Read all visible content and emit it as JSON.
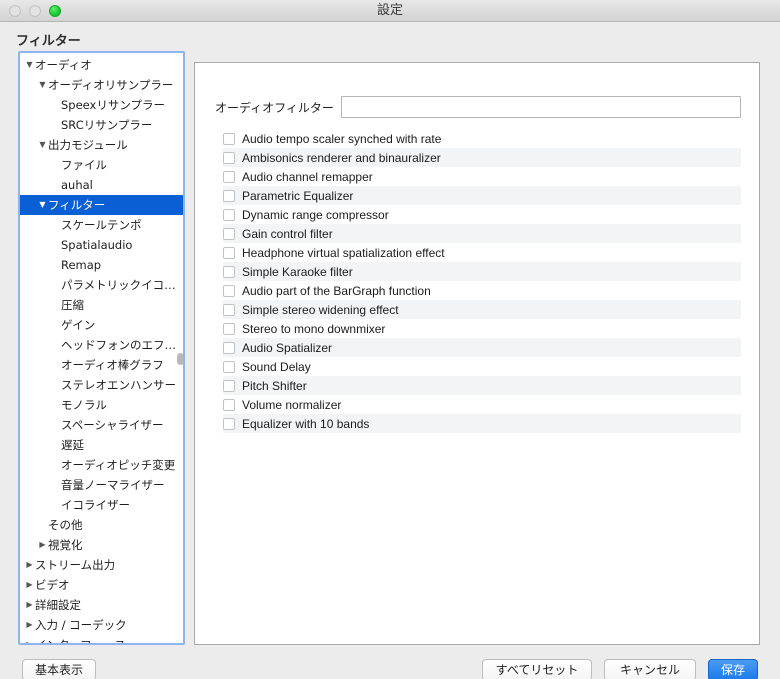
{
  "window": {
    "title": "設定",
    "traffic_lights": [
      "close-button",
      "minimize-button",
      "maximize-button"
    ],
    "accent_blue": "#0a5fd4",
    "save_blue": "#1b7ae8"
  },
  "page": {
    "heading": "フィルター"
  },
  "tree": {
    "items": [
      {
        "label": "オーディオ",
        "level": 0,
        "twisty": "▼",
        "selected": false
      },
      {
        "label": "オーディオリサンプラー",
        "level": 1,
        "twisty": "▼",
        "selected": false
      },
      {
        "label": "Speexリサンプラー",
        "level": 2,
        "twisty": "",
        "selected": false
      },
      {
        "label": "SRCリサンプラー",
        "level": 2,
        "twisty": "",
        "selected": false
      },
      {
        "label": "出力モジュール",
        "level": 1,
        "twisty": "▼",
        "selected": false
      },
      {
        "label": "ファイル",
        "level": 2,
        "twisty": "",
        "selected": false
      },
      {
        "label": "auhal",
        "level": 2,
        "twisty": "",
        "selected": false
      },
      {
        "label": "フィルター",
        "level": 1,
        "twisty": "▼",
        "selected": true
      },
      {
        "label": "スケールテンポ",
        "level": 2,
        "twisty": "",
        "selected": false
      },
      {
        "label": "Spatialaudio",
        "level": 2,
        "twisty": "",
        "selected": false
      },
      {
        "label": "Remap",
        "level": 2,
        "twisty": "",
        "selected": false
      },
      {
        "label": "パラメトリックイコ…",
        "level": 2,
        "twisty": "",
        "selected": false
      },
      {
        "label": "圧縮",
        "level": 2,
        "twisty": "",
        "selected": false
      },
      {
        "label": "ゲイン",
        "level": 2,
        "twisty": "",
        "selected": false
      },
      {
        "label": "ヘッドフォンのエフ…",
        "level": 2,
        "twisty": "",
        "selected": false
      },
      {
        "label": "オーディオ棒グラフ",
        "level": 2,
        "twisty": "",
        "selected": false
      },
      {
        "label": "ステレオエンハンサー",
        "level": 2,
        "twisty": "",
        "selected": false
      },
      {
        "label": "モノラル",
        "level": 2,
        "twisty": "",
        "selected": false
      },
      {
        "label": "スペーシャライザー",
        "level": 2,
        "twisty": "",
        "selected": false
      },
      {
        "label": "遅延",
        "level": 2,
        "twisty": "",
        "selected": false
      },
      {
        "label": "オーディオピッチ変更",
        "level": 2,
        "twisty": "",
        "selected": false
      },
      {
        "label": "音量ノーマライザー",
        "level": 2,
        "twisty": "",
        "selected": false
      },
      {
        "label": "イコライザー",
        "level": 2,
        "twisty": "",
        "selected": false
      },
      {
        "label": "その他",
        "level": 1,
        "twisty": "",
        "selected": false
      },
      {
        "label": "視覚化",
        "level": 1,
        "twisty": "▶",
        "selected": false
      },
      {
        "label": "ストリーム出力",
        "level": 0,
        "twisty": "▶",
        "selected": false
      },
      {
        "label": "ビデオ",
        "level": 0,
        "twisty": "▶",
        "selected": false
      },
      {
        "label": "詳細設定",
        "level": 0,
        "twisty": "▶",
        "selected": false
      },
      {
        "label": "入力 / コーデック",
        "level": 0,
        "twisty": "▶",
        "selected": false
      },
      {
        "label": "インターフェース",
        "level": 0,
        "twisty": "▶",
        "selected": false
      }
    ]
  },
  "filter_section": {
    "label": "オーディオフィルター",
    "input_value": "",
    "input_placeholder": ""
  },
  "checkboxes": [
    {
      "label": "Audio tempo scaler synched with rate",
      "checked": false
    },
    {
      "label": "Ambisonics renderer and binauralizer",
      "checked": false
    },
    {
      "label": "Audio channel remapper",
      "checked": false
    },
    {
      "label": "Parametric Equalizer",
      "checked": false
    },
    {
      "label": "Dynamic range compressor",
      "checked": false
    },
    {
      "label": "Gain control filter",
      "checked": false
    },
    {
      "label": "Headphone virtual spatialization effect",
      "checked": false
    },
    {
      "label": "Simple Karaoke filter",
      "checked": false
    },
    {
      "label": "Audio part of the BarGraph function",
      "checked": false
    },
    {
      "label": "Simple stereo widening effect",
      "checked": false
    },
    {
      "label": "Stereo to mono downmixer",
      "checked": false
    },
    {
      "label": "Audio Spatializer",
      "checked": false
    },
    {
      "label": "Sound Delay",
      "checked": false
    },
    {
      "label": "Pitch Shifter",
      "checked": false
    },
    {
      "label": "Volume normalizer",
      "checked": false
    },
    {
      "label": "Equalizer with 10 bands",
      "checked": false
    }
  ],
  "footer": {
    "basic_view": "基本表示",
    "reset_all": "すべてリセット",
    "cancel": "キャンセル",
    "save": "保存"
  }
}
